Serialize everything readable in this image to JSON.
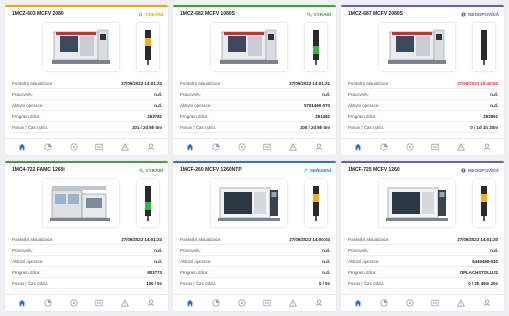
{
  "colors": {
    "orange": "#f2a31c",
    "green": "#3fa13f",
    "blue": "#2f76c4",
    "purple": "#6a5fbf",
    "red": "#d9302f",
    "nav_icon": "#9aa3ad",
    "nav_active": "#2f6fc0"
  },
  "labels": {
    "last_update": "Poslední aktualizace:",
    "worker": "Pracovník:",
    "active_op": "Aktivní operace:",
    "program": "Program dílce:",
    "feed": "Posuv / Čas cyklu:"
  },
  "cards": [
    {
      "name": "1MCZ-603 MCFV 2080",
      "status": "ČEKÁNÍ",
      "status_icon": "pause-icon",
      "machine": "mill-vertical",
      "last_update": "27/09/2023 14:01:23",
      "worker": "n.d.",
      "active_op": "n.d.",
      "program": "263781",
      "feed": "101 / 2d 8h 0m"
    },
    {
      "name": "1MCZ-682 MCFV 1080S",
      "status": "VYRÁBÍ",
      "status_icon": "gears-icon",
      "machine": "mill-vertical",
      "last_update": "27/09/2023 14:01:21",
      "worker": "n.d.",
      "active_op": "5751460-070",
      "program": "251492",
      "feed": "100 / 2d 8h 0m"
    },
    {
      "name": "1MCZ-687 MCFV 2080S",
      "status": "NEODPOVÍDÁ",
      "status_icon": "offline-icon",
      "machine": "mill-vertical",
      "last_update": "27/09/2023 10:49:52",
      "worker": "n.d.",
      "active_op": "n.d.",
      "program": "252861",
      "feed": "0 / 1d 1h 20m"
    },
    {
      "name": "1MC4-722 FAMC 1260i",
      "status": "VYRÁBÍ",
      "status_icon": "gears-icon",
      "machine": "cell",
      "last_update": "27/09/2023 14:01:24",
      "worker": "n.d.",
      "active_op": "n.d.",
      "program": "802773",
      "feed": "100 / 0s"
    },
    {
      "name": "1MCF-260 MCFV 1260NTP",
      "status": "SEŘIZENÍ",
      "status_icon": "wrench-icon",
      "machine": "center",
      "last_update": "27/09/2023 14:00:04",
      "worker": "n.d.",
      "active_op": "n.d.",
      "program": "n.d.",
      "feed": "0 / 0s"
    },
    {
      "name": "1MCF-725 MCFV 1260",
      "status": "NEODPOVÍDÁ",
      "status_icon": "offline-icon",
      "machine": "center",
      "last_update": "27/09/2023 14:01:20",
      "worker": "n.d.",
      "active_op": "5449480-010",
      "program": "OPLACHSTOLUJ1",
      "feed": "0 / 2h 49m 20s"
    }
  ],
  "nav_icons": [
    "home-icon",
    "pie-chart-icon",
    "gauge-icon",
    "list-icon",
    "warning-icon",
    "user-icon"
  ]
}
